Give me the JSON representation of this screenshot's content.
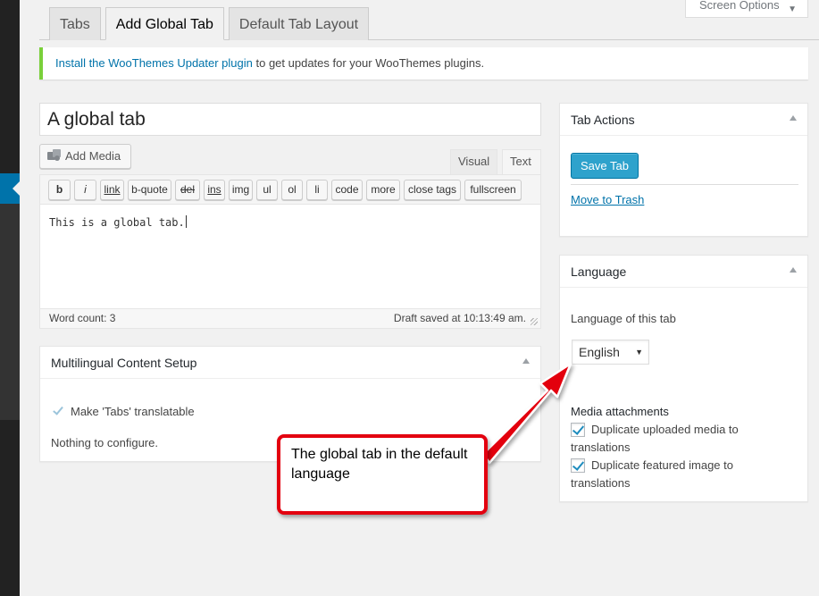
{
  "screen_options": {
    "label": "Screen Options",
    "caret_icon": "caret-down-icon"
  },
  "tabs": [
    {
      "label": "Tabs"
    },
    {
      "label": "Add Global Tab"
    },
    {
      "label": "Default Tab Layout"
    }
  ],
  "notice": {
    "link_text": "Install the WooThemes Updater plugin",
    "rest_text": " to get updates for your WooThemes plugins."
  },
  "editor": {
    "title_value": "A global tab",
    "add_media_label": "Add Media",
    "tab_visual": "Visual",
    "tab_text": "Text",
    "quicktags": [
      "b",
      "i",
      "link",
      "b-quote",
      "del",
      "ins",
      "img",
      "ul",
      "ol",
      "li",
      "code",
      "more",
      "close tags",
      "fullscreen"
    ],
    "content": "This is a global tab.",
    "word_count": "Word count: 3",
    "draft_saved": "Draft saved at 10:13:49 am."
  },
  "multilingual": {
    "title": "Multilingual Content Setup",
    "checkbox_label": "Make 'Tabs' translatable",
    "nothing_text": "Nothing to configure."
  },
  "tab_actions": {
    "title": "Tab Actions",
    "save_label": "Save Tab",
    "trash_label": "Move to Trash"
  },
  "language": {
    "title": "Language",
    "label": "Language of this tab",
    "selected": "English",
    "media_title": "Media attachments",
    "dup_media": "Duplicate uploaded media to translations",
    "dup_featured": "Duplicate featured image to translations"
  },
  "callout": {
    "text": "The global tab in the default language",
    "colors": {
      "border": "#e3000f"
    }
  },
  "colors": {
    "accent": "#0073aa",
    "primary_button": "#2ea2cc",
    "notice_border": "#7ad03a",
    "admin_bar": "#222222"
  }
}
